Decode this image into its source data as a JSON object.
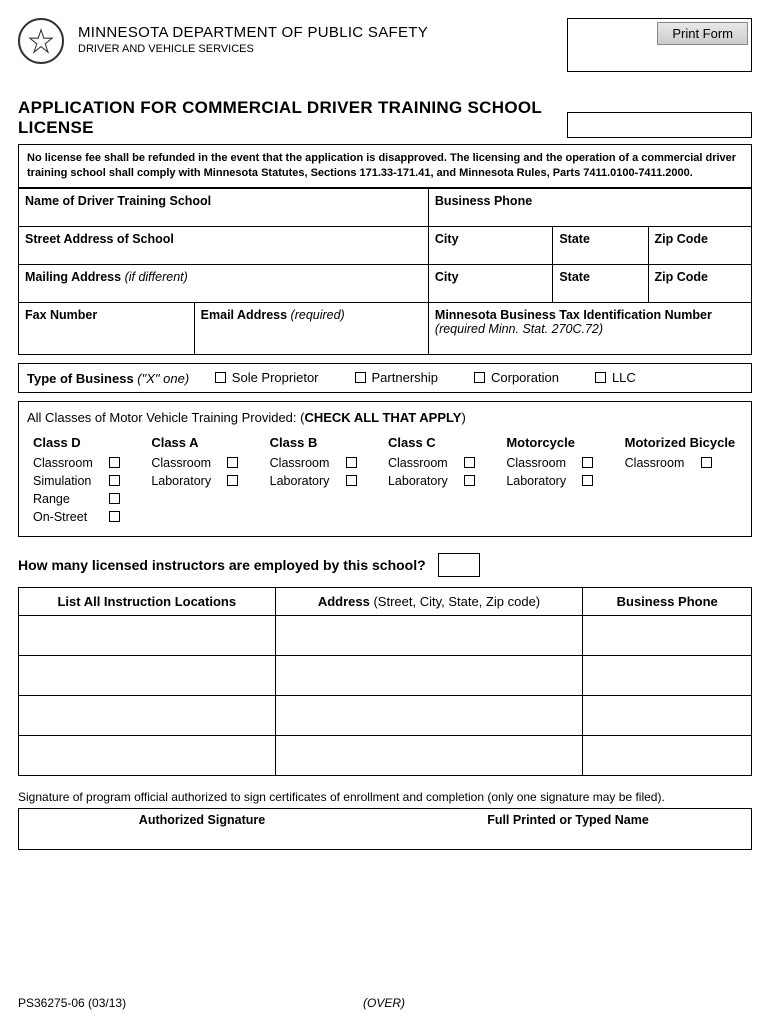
{
  "header": {
    "dept": "MINNESOTA  DEPARTMENT OF PUBLIC SAFETY",
    "division": "DRIVER AND VEHICLE SERVICES",
    "print_btn": "Print Form"
  },
  "title": "APPLICATION FOR COMMERCIAL DRIVER TRAINING SCHOOL LICENSE",
  "notice": "No license fee shall be refunded in the event that the application is disapproved. The licensing and the operation of a commercial driver training school shall comply with Minnesota Statutes, Sections 171.33-171.41, and Minnesota Rules, Parts 7411.0100-7411.2000.",
  "fields": {
    "school_name": "Name of Driver Training School",
    "business_phone": "Business Phone",
    "street": "Street Address of School",
    "city": "City",
    "state": "State",
    "zip": "Zip Code",
    "mailing": "Mailing Address",
    "mailing_hint": " (if different)",
    "fax": "Fax Number",
    "email": "Email Address",
    "email_hint": " (required)",
    "tax_id": "Minnesota Business Tax Identification Number",
    "tax_hint": " (required Minn. Stat. 270C.72)"
  },
  "type_of_business": {
    "label": "Type of Business",
    "hint": " (\"X\" one)",
    "options": [
      "Sole Proprietor",
      "Partnership",
      "Corporation",
      "LLC"
    ]
  },
  "classes": {
    "header_pre": "All Classes of Motor Vehicle Training Provided: (",
    "header_bold": "CHECK ALL THAT APPLY",
    "header_post": ")",
    "columns": [
      {
        "title": "Class D",
        "rows": [
          "Classroom",
          "Simulation",
          "Range",
          "On-Street"
        ]
      },
      {
        "title": "Class A",
        "rows": [
          "Classroom",
          "Laboratory"
        ]
      },
      {
        "title": "Class B",
        "rows": [
          "Classroom",
          "Laboratory"
        ]
      },
      {
        "title": "Class C",
        "rows": [
          "Classroom",
          "Laboratory"
        ]
      },
      {
        "title": "Motorcycle",
        "rows": [
          "Classroom",
          "Laboratory"
        ]
      },
      {
        "title": "Motorized Bicycle",
        "rows": [
          "Classroom"
        ]
      }
    ]
  },
  "instructor_q": "How many licensed instructors are employed by this school?",
  "locations_table": {
    "headers": {
      "locations": "List All Instruction Locations",
      "address_pre": "Address",
      "address_hint": " (Street, City, State, Zip code)",
      "phone": "Business Phone"
    }
  },
  "signature": {
    "note": "Signature of program official authorized to sign certificates of enrollment and completion (only one signature may be filed).",
    "auth": "Authorized Signature",
    "name": "Full Printed or Typed Name"
  },
  "footer": {
    "form_no": "PS36275-06 (03/13)",
    "over": "(OVER)"
  }
}
